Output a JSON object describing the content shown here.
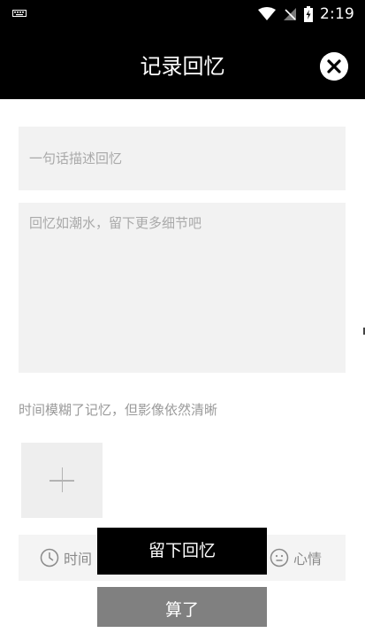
{
  "status_bar": {
    "time": "2:19",
    "icons": [
      "keyboard-icon",
      "wifi-icon",
      "no-signal-icon",
      "battery-charging-icon"
    ]
  },
  "header": {
    "title": "记录回忆",
    "close_icon": "close-icon"
  },
  "form": {
    "summary_placeholder": "一句话描述回忆",
    "detail_placeholder": "回忆如潮水，留下更多细节吧",
    "photo_hint": "时间模糊了记忆，但影像依然清晰",
    "add_photo_icon": "plus-icon"
  },
  "meta_bar": {
    "time_label": "时间",
    "mood_label": "心情"
  },
  "actions": {
    "save_label": "留下回忆",
    "cancel_label": "算了"
  },
  "colors": {
    "header_bg": "#000000",
    "field_bg": "#f2f2f2",
    "placeholder": "#a9a9a9",
    "save_bg": "#000000",
    "cancel_bg": "#808080"
  }
}
